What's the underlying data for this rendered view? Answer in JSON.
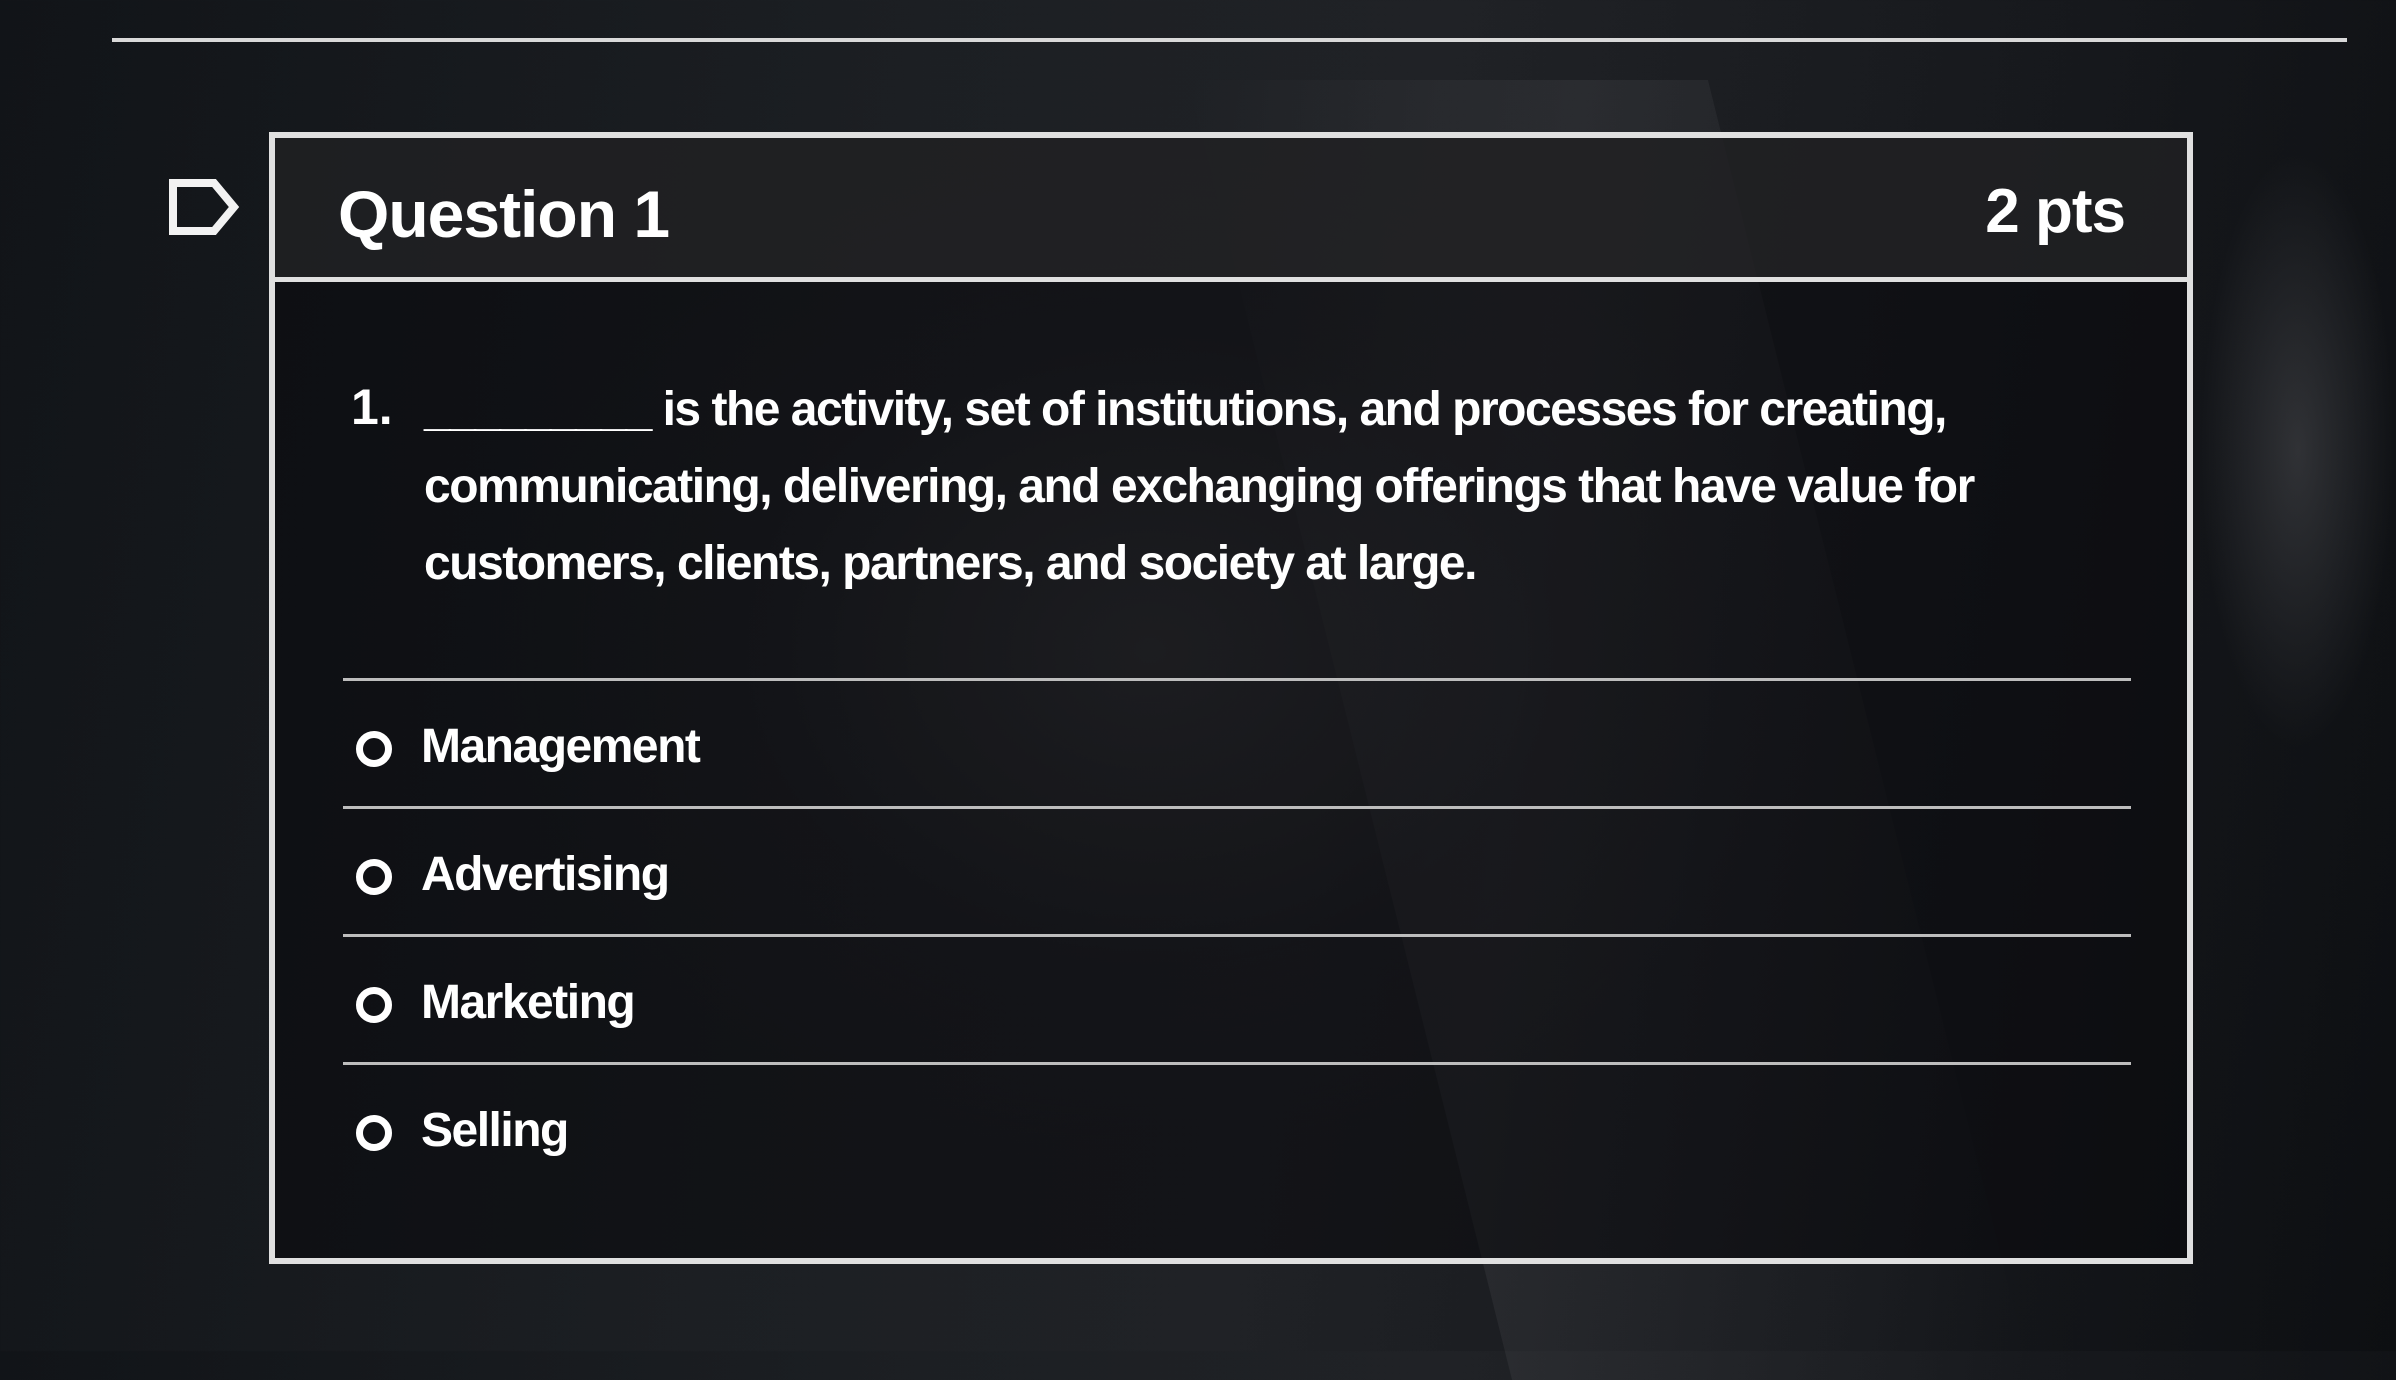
{
  "question": {
    "title": "Question 1",
    "points": "2 pts",
    "number": "1.",
    "text": "_________ is the activity, set of institutions, and processes for creating, communicating, delivering, and exchanging offerings that have value for customers, clients, partners, and society at large."
  },
  "answers": [
    {
      "label": "Management"
    },
    {
      "label": "Advertising"
    },
    {
      "label": "Marketing"
    },
    {
      "label": "Selling"
    }
  ],
  "icons": {
    "flag": "flag-outline-icon",
    "radio": "radio-unselected-icon"
  },
  "colors": {
    "text": "#ffffff",
    "border": "#e0e0e0",
    "background": "#16181c"
  }
}
